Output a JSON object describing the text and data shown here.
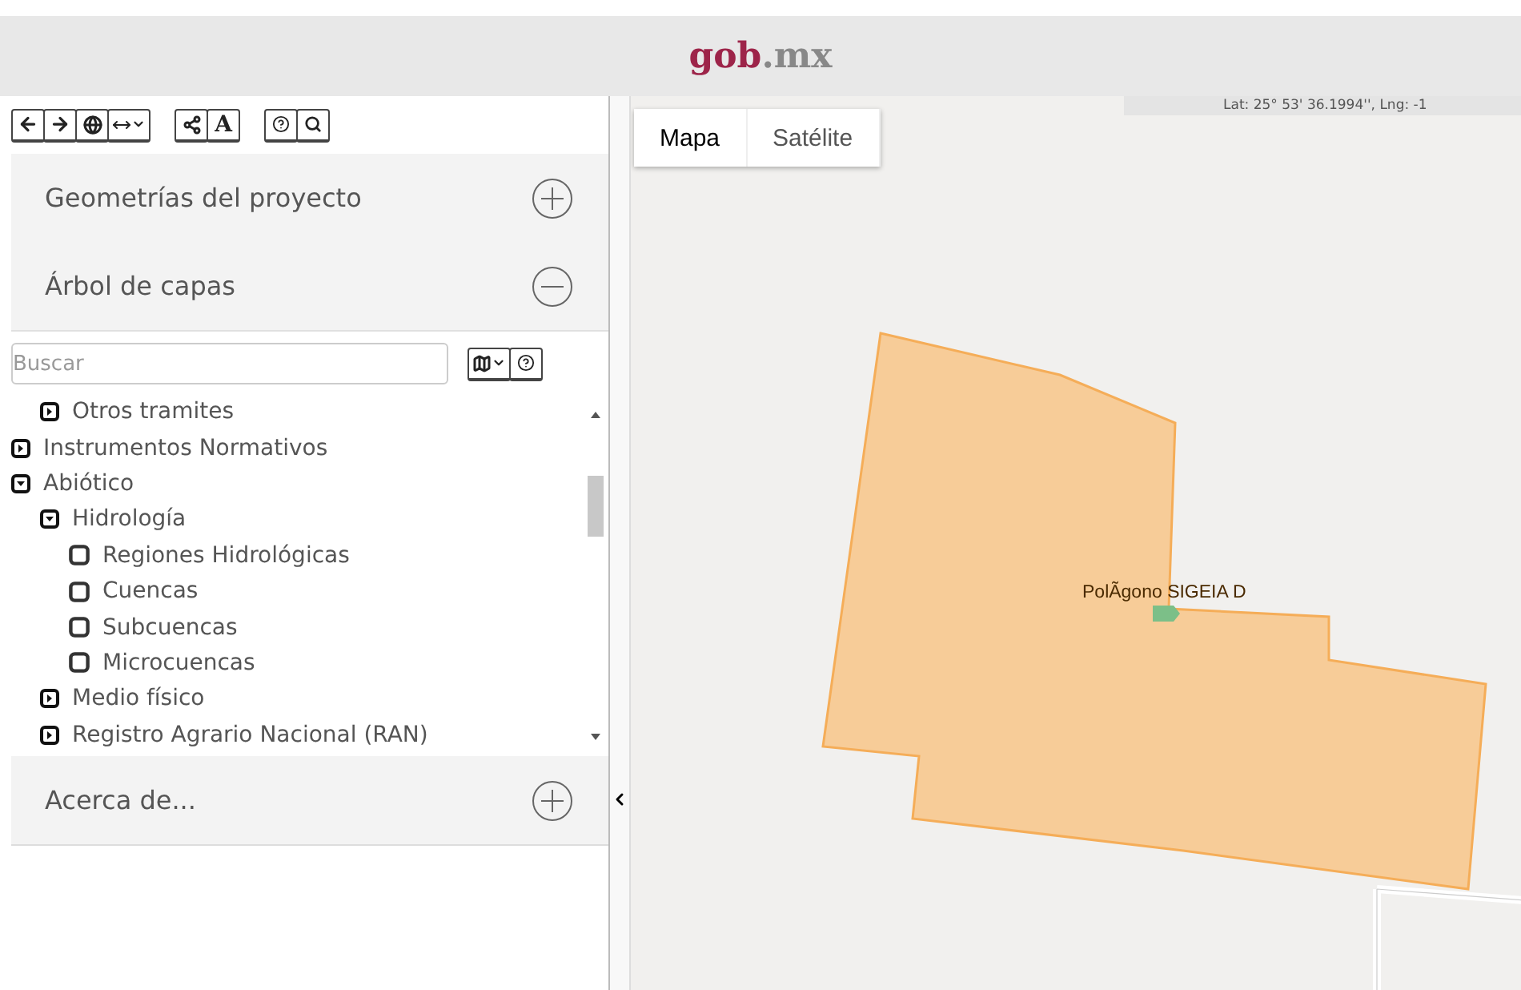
{
  "header": {
    "logo_main": "gob",
    "logo_suffix": ".mx"
  },
  "toolbar": {
    "font_button": "A"
  },
  "panels": [
    {
      "title": "Geometrías del proyecto",
      "expanded": false
    },
    {
      "title": "Árbol de capas",
      "expanded": true
    }
  ],
  "search": {
    "placeholder": "Buscar"
  },
  "tree": [
    {
      "children": [
        {
          "label": "Otros tramites",
          "kind": "folder",
          "expanded": false
        }
      ]
    },
    {
      "label": "Instrumentos Normativos",
      "kind": "folder",
      "expanded": false
    },
    {
      "label": "Abiótico",
      "kind": "folder",
      "expanded": true,
      "children": [
        {
          "label": "Hidrología",
          "kind": "folder",
          "expanded": true,
          "children": [
            {
              "label": "Regiones Hidrológicas",
              "kind": "layer",
              "checked": false
            },
            {
              "label": "Cuencas",
              "kind": "layer",
              "checked": false
            },
            {
              "label": "Subcuencas",
              "kind": "layer",
              "checked": false
            },
            {
              "label": "Microcuencas",
              "kind": "layer",
              "checked": false
            }
          ]
        },
        {
          "label": "Medio físico",
          "kind": "folder",
          "expanded": false
        },
        {
          "label": "Registro Agrario Nacional (RAN)",
          "kind": "folder",
          "expanded": false
        }
      ]
    }
  ],
  "about_panel": {
    "title": "Acerca de...",
    "expanded": false
  },
  "map": {
    "tabs": [
      {
        "label": "Mapa",
        "selected": true
      },
      {
        "label": "Satélite",
        "selected": false
      }
    ],
    "coordinates": "Lat: 25° 53' 36.1994'', Lng: -1",
    "polygon_label": "PolÃgono SIGEIA D"
  }
}
